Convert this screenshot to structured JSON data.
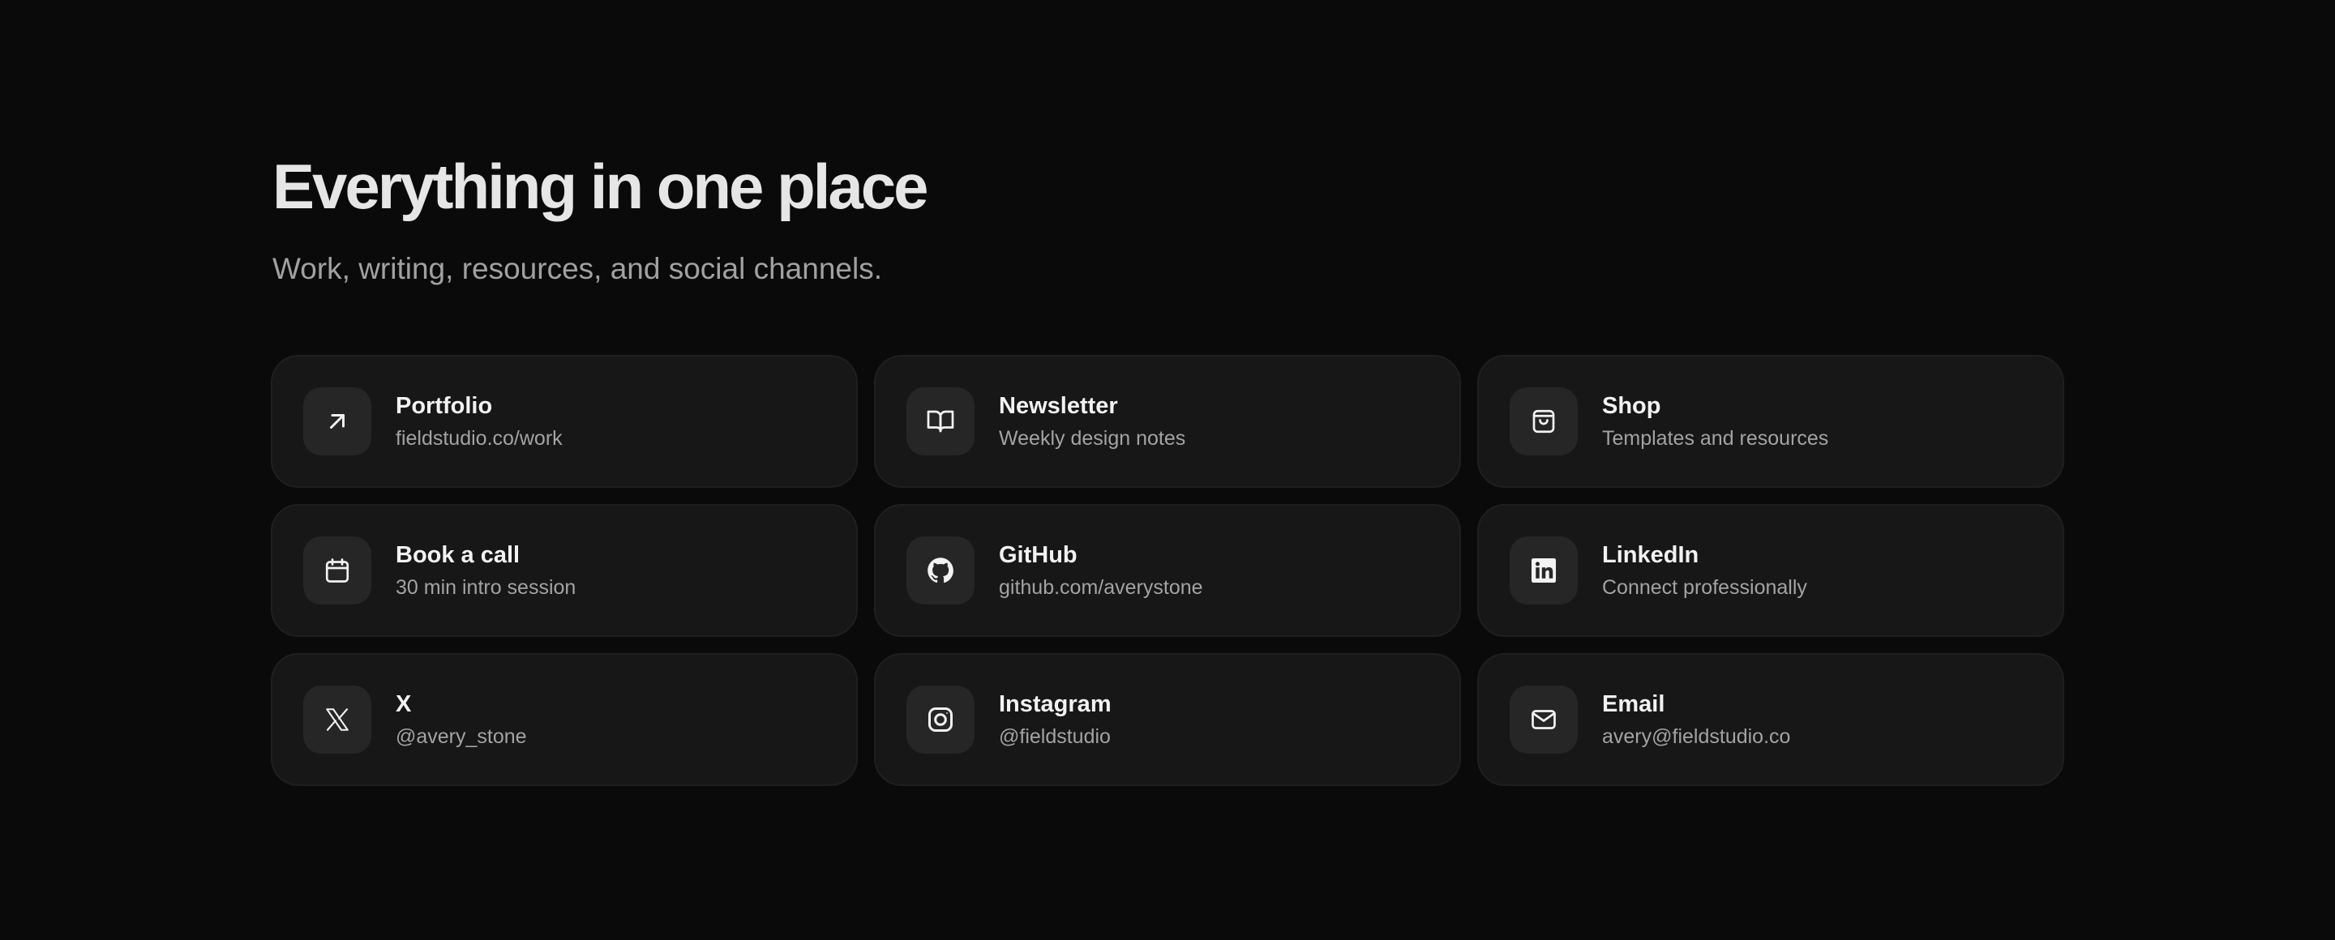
{
  "header": {
    "title": "Everything in one place",
    "subtitle": "Work, writing, resources, and social channels."
  },
  "links": [
    {
      "label": "Portfolio",
      "detail": "fieldstudio.co/work",
      "icon": "arrow-up-right-icon"
    },
    {
      "label": "Newsletter",
      "detail": "Weekly design notes",
      "icon": "book-open-icon"
    },
    {
      "label": "Shop",
      "detail": "Templates and resources",
      "icon": "shopping-bag-icon"
    },
    {
      "label": "Book a call",
      "detail": "30 min intro session",
      "icon": "calendar-icon"
    },
    {
      "label": "GitHub",
      "detail": "github.com/averystone",
      "icon": "github-icon"
    },
    {
      "label": "LinkedIn",
      "detail": "Connect professionally",
      "icon": "linkedin-icon"
    },
    {
      "label": "X",
      "detail": "@avery_stone",
      "icon": "x-logo-icon"
    },
    {
      "label": "Instagram",
      "detail": "@fieldstudio",
      "icon": "instagram-icon"
    },
    {
      "label": "Email",
      "detail": "avery@fieldstudio.co",
      "icon": "mail-icon"
    }
  ],
  "colors": {
    "background": "#0a0a0a",
    "card": "#171717",
    "icon_tile": "#262626",
    "title": "#e6e6e6",
    "muted_text": "#a3a3a3"
  }
}
